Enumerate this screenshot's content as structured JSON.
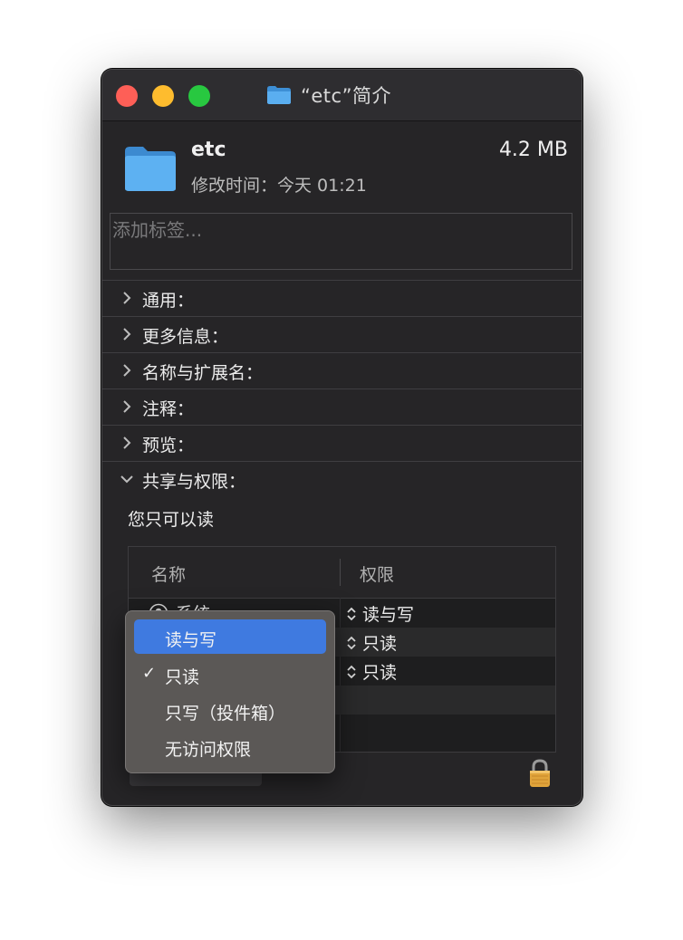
{
  "window": {
    "title": "“etc”简介"
  },
  "header": {
    "name": "etc",
    "size": "4.2 MB",
    "modified": "修改时间：今天 01:21"
  },
  "tags": {
    "placeholder": "添加标签..."
  },
  "sections": [
    {
      "label": "通用：",
      "expanded": false
    },
    {
      "label": "更多信息：",
      "expanded": false
    },
    {
      "label": "名称与扩展名：",
      "expanded": false
    },
    {
      "label": "注释：",
      "expanded": false
    },
    {
      "label": "预览：",
      "expanded": false
    },
    {
      "label": "共享与权限：",
      "expanded": true
    }
  ],
  "sharing": {
    "note": "您只可以读",
    "columns": {
      "name": "名称",
      "permission": "权限"
    },
    "rows": [
      {
        "name": "系统",
        "permission": "读与写"
      },
      {
        "name": "",
        "permission": "只读"
      },
      {
        "name": "",
        "permission": "只读"
      }
    ]
  },
  "permission_menu": {
    "items": [
      {
        "label": "读与写",
        "highlighted": true,
        "checked": false
      },
      {
        "label": "只读",
        "highlighted": false,
        "checked": true
      },
      {
        "label": "只写（投件箱）",
        "highlighted": false,
        "checked": false
      },
      {
        "label": "无访问权限",
        "highlighted": false,
        "checked": false
      }
    ],
    "check_glyph": "✓"
  },
  "colors": {
    "window_bg": "#262527",
    "accent_highlight": "#3f7ae0",
    "close": "#fe5f57",
    "minimize": "#febc2e",
    "zoom": "#28c840",
    "folder": "#5aaef0"
  }
}
